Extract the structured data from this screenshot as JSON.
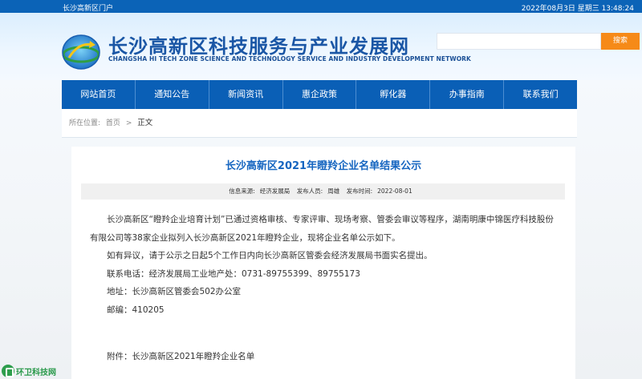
{
  "topbar": {
    "portal": "长沙高新区门户",
    "date": "2022年08月3日 星期三 13:48:24"
  },
  "header": {
    "title": "长沙高新区科技服务与产业发展网",
    "subtitle": "CHANGSHA HI TECH ZONE SCIENCE AND TECHNOLOGY SERVICE AND INDUSTRY DEVELOPMENT NETWORK",
    "logo_icon": "globe-arrow-logo-icon"
  },
  "search": {
    "value": "",
    "placeholder": "",
    "button_label": "搜索",
    "button_color": "#f68a18"
  },
  "nav": {
    "items": [
      {
        "label": "网站首页"
      },
      {
        "label": "通知公告"
      },
      {
        "label": "新闻资讯"
      },
      {
        "label": "惠企政策"
      },
      {
        "label": "孵化器"
      },
      {
        "label": "办事指南"
      },
      {
        "label": "联系我们"
      }
    ],
    "bg_color": "#0a5fb6"
  },
  "breadcrumb": {
    "prefix": "所在位置:",
    "home": "首页",
    "separator": ">",
    "current": "正文"
  },
  "article": {
    "title": "长沙高新区2021年瞪羚企业名单结果公示",
    "meta": {
      "source_label": "信息来源:",
      "source": "经济发展局",
      "publisher_label": "发布人员:",
      "publisher": "周雄",
      "time_label": "发布时间:",
      "time": "2022-08-01"
    },
    "paragraphs": [
      "长沙高新区“瞪羚企业培育计划”已通过资格审核、专家评审、现场考察、管委会审议等程序，湖南明康中锦医疗科技股份有限公司等38家企业拟列入长沙高新区2021年瞪羚企业，现将企业名单公示如下。",
      "如有异议，请于公示之日起5个工作日内向长沙高新区管委会经济发展局书面实名提出。",
      "联系电话：经济发展局工业地产处：0731-89755399、89755173",
      "地址：长沙高新区管委会502办公室",
      "邮编：410205"
    ],
    "attachment": "附件：长沙高新区2021年瞪羚企业名单"
  },
  "watermark": {
    "text": "环卫科技网",
    "icon": "huanwei-logo-icon",
    "color": "#2a9a4b"
  }
}
